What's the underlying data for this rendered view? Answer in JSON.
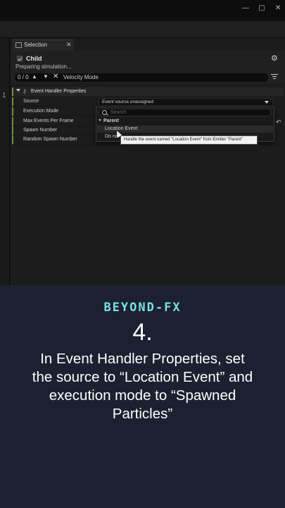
{
  "window": {
    "controls": [
      "—",
      "▢",
      "✕"
    ]
  },
  "left_gutter": {
    "char": "1"
  },
  "tab": {
    "label": "Selection",
    "close": "✕"
  },
  "selection": {
    "name": "Child",
    "status": "Preparing simulation...",
    "gear": "⚙"
  },
  "search": {
    "match_count": "0 / 0",
    "up": "▲",
    "down": "▼",
    "clear": "✕",
    "text": "Velocity Mode"
  },
  "section": {
    "icon": "🔑",
    "title": "Event Handler Properties"
  },
  "properties": [
    {
      "label": "Source",
      "value": "Event source unassigned"
    },
    {
      "label": "Execution Mode"
    },
    {
      "label": "Max Events Per Frame"
    },
    {
      "label": "Spawn Number"
    },
    {
      "label": "Random Spawn Number"
    }
  ],
  "dropdown": {
    "search_placeholder": "Search",
    "group": "Parent",
    "items": [
      "Location Event",
      "Do no"
    ]
  },
  "tooltip": {
    "text": "Handle the event named \"Location Event\" from Emitter \"Parent\""
  },
  "reset_icon": "↶",
  "caption": {
    "brand": "BEYOND-FX",
    "step": "4.",
    "instruction": "In Event Handler Properties, set the source to “Location Event” and execution mode to “Spawned Particles”"
  },
  "colors": {
    "caption_bg": "#1c2030",
    "brand": "#78e0e6",
    "section_accent": "#6b8d3a"
  }
}
